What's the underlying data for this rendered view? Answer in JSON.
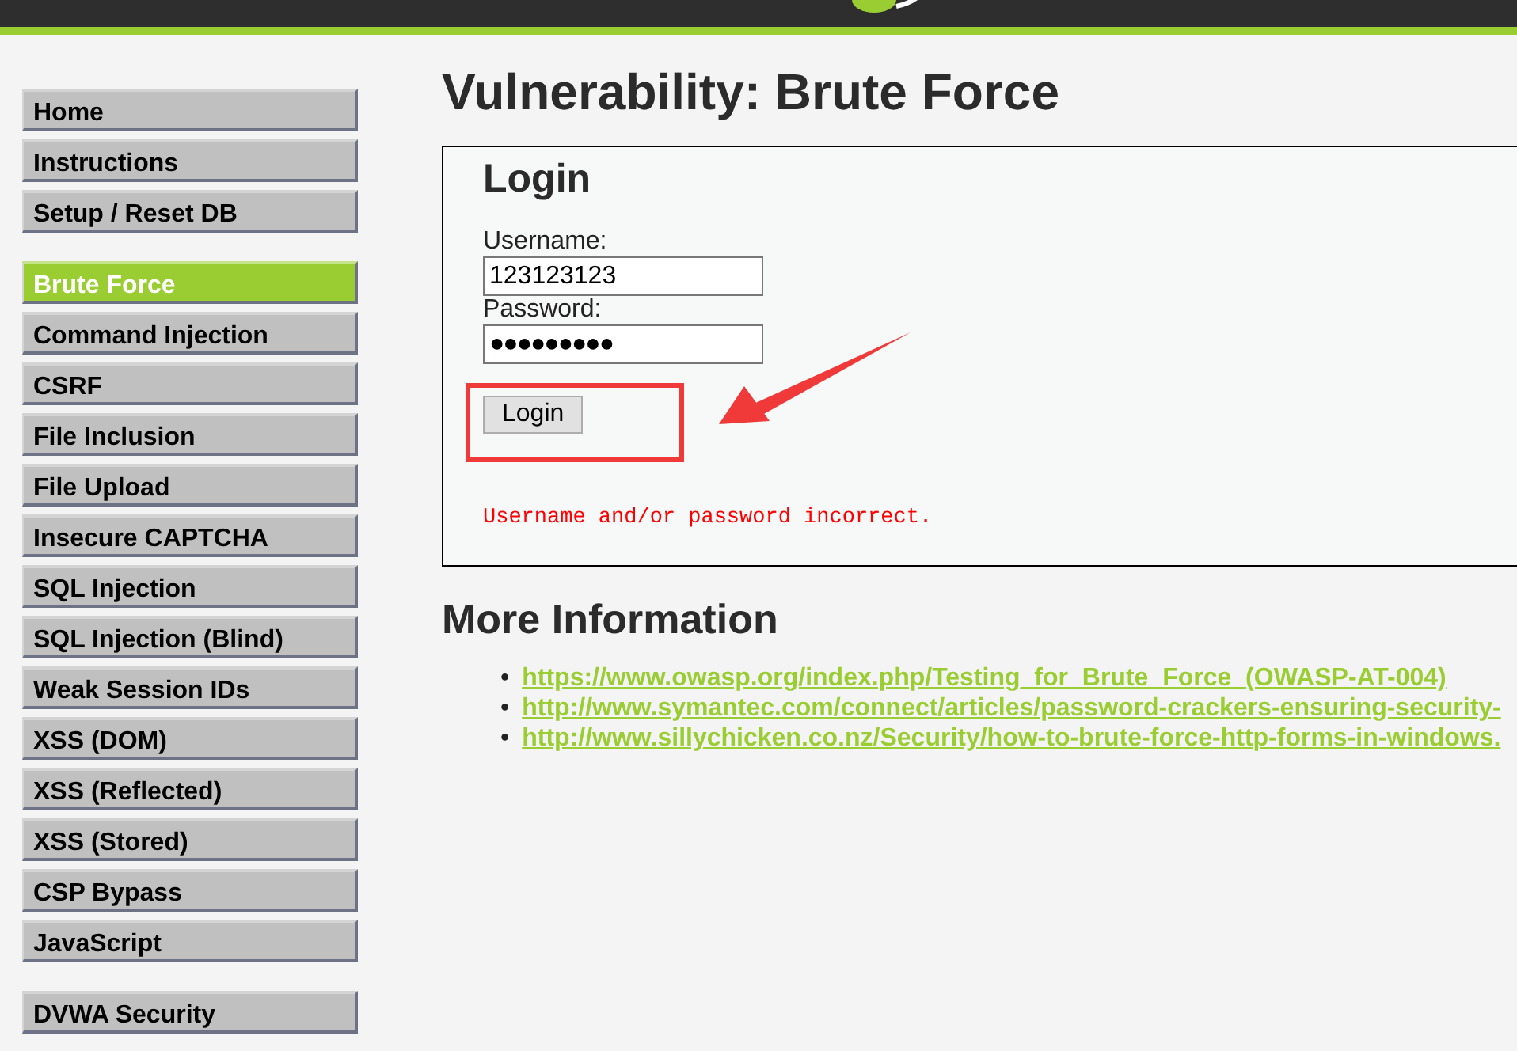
{
  "menu_groups": [
    {
      "items": [
        {
          "label": "Home",
          "selected": false
        },
        {
          "label": "Instructions",
          "selected": false
        },
        {
          "label": "Setup / Reset DB",
          "selected": false
        }
      ]
    },
    {
      "items": [
        {
          "label": "Brute Force",
          "selected": true
        },
        {
          "label": "Command Injection",
          "selected": false
        },
        {
          "label": "CSRF",
          "selected": false
        },
        {
          "label": "File Inclusion",
          "selected": false
        },
        {
          "label": "File Upload",
          "selected": false
        },
        {
          "label": "Insecure CAPTCHA",
          "selected": false
        },
        {
          "label": "SQL Injection",
          "selected": false
        },
        {
          "label": "SQL Injection (Blind)",
          "selected": false
        },
        {
          "label": "Weak Session IDs",
          "selected": false
        },
        {
          "label": "XSS (DOM)",
          "selected": false
        },
        {
          "label": "XSS (Reflected)",
          "selected": false
        },
        {
          "label": "XSS (Stored)",
          "selected": false
        },
        {
          "label": "CSP Bypass",
          "selected": false
        },
        {
          "label": "JavaScript",
          "selected": false
        }
      ]
    },
    {
      "items": [
        {
          "label": "DVWA Security",
          "selected": false
        }
      ]
    }
  ],
  "page_title": "Vulnerability: Brute Force",
  "login": {
    "title": "Login",
    "username_label": "Username:",
    "username_value": "123123123",
    "password_label": "Password:",
    "password_value": "●●●●●●●●●",
    "button": "Login",
    "error": "Username and/or password incorrect."
  },
  "more_info": {
    "title": "More Information",
    "bullet": "•",
    "links": [
      "https://www.owasp.org/index.php/Testing_for_Brute_Force_(OWASP-AT-004)",
      "http://www.symantec.com/connect/articles/password-crackers-ensuring-security-",
      "http://www.sillychicken.co.nz/Security/how-to-brute-force-http-forms-in-windows."
    ]
  }
}
